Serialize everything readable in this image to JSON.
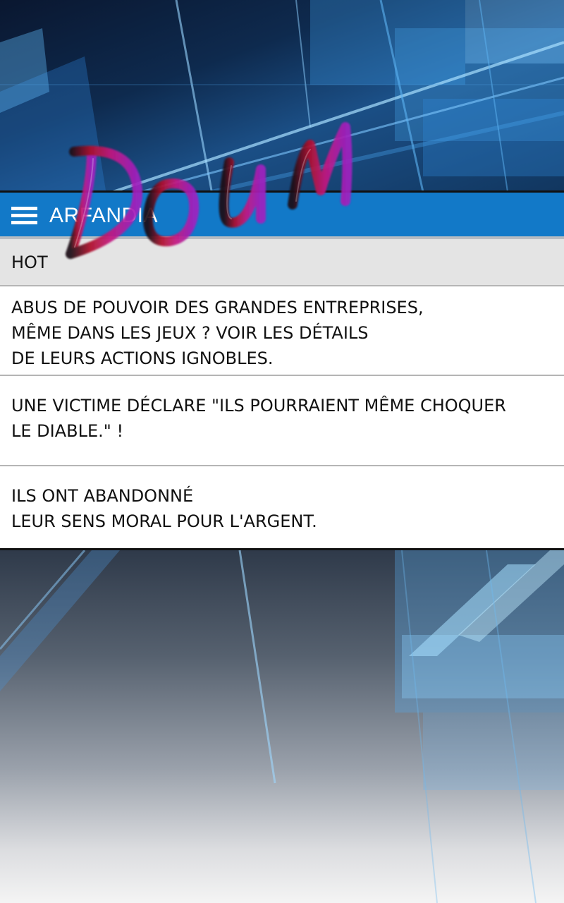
{
  "header": {
    "title": "ARFANDIA",
    "menu_icon": "hamburger-menu-icon",
    "color": "#1279c8"
  },
  "section": {
    "label": "HOT"
  },
  "news": [
    {
      "text": "ABUS DE POUVOIR DES GRANDES ENTREPRISES,\nMÊME DANS LES JEUX ? VOIR LES DÉTAILS\nDE LEURS ACTIONS IGNOBLES."
    },
    {
      "text": "UNE VICTIME DÉCLARE \"ILS POURRAIENT MÊME CHOQUER\nLE DIABLE.\" !"
    },
    {
      "text": "ILS ONT ABANDONNÉ\nLEUR SENS MORAL POUR L'ARGENT."
    }
  ],
  "sfx": {
    "text": "DOUM",
    "colors": [
      "#1a0a14",
      "#b0102a",
      "#c41880",
      "#a020c0"
    ]
  }
}
